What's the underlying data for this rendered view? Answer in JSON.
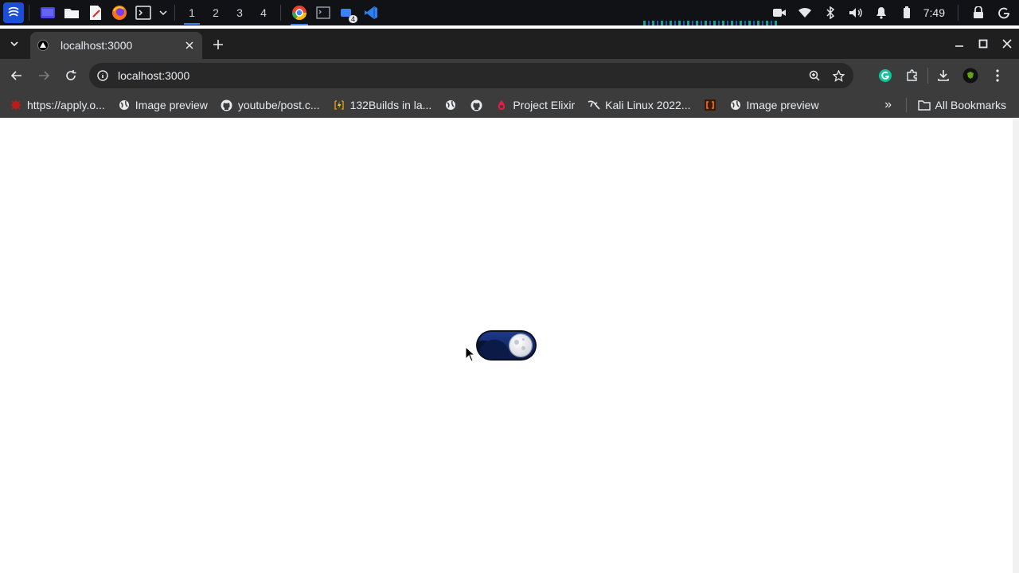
{
  "taskbar": {
    "workspaces": [
      "1",
      "2",
      "3",
      "4"
    ],
    "active_workspace": "1",
    "notification_count": "4",
    "clock": "7:49"
  },
  "browser": {
    "tab": {
      "title": "localhost:3000"
    },
    "address": {
      "url": "localhost:3000"
    },
    "bookmarks": [
      {
        "label": "https://apply.o...",
        "icon": "bookmark-site-icon"
      },
      {
        "label": "Image preview",
        "icon": "globe-icon"
      },
      {
        "label": "youtube/post.c...",
        "icon": "github-icon"
      },
      {
        "label": "132Builds in la...",
        "icon": "bolt-icon"
      },
      {
        "label": "",
        "icon": "globe-icon"
      },
      {
        "label": "",
        "icon": "github-icon"
      },
      {
        "label": "Project Elixir",
        "icon": "elixir-icon"
      },
      {
        "label": "Kali Linux 2022...",
        "icon": "kali-icon"
      },
      {
        "label": "",
        "icon": "orange-bracket-icon"
      },
      {
        "label": "Image preview",
        "icon": "globe-icon"
      }
    ],
    "more_bookmarks": "»",
    "all_bookmarks": "All Bookmarks"
  },
  "page": {
    "theme_toggle": {
      "state": "dark",
      "mode": "night"
    }
  },
  "colors": {
    "taskbar_bg": "#101216",
    "chrome_dark": "#1f1f1f",
    "chrome_toolbar": "#3c3c3c",
    "accent_blue": "#3b82f6",
    "toggle_night": "#142a6b"
  }
}
